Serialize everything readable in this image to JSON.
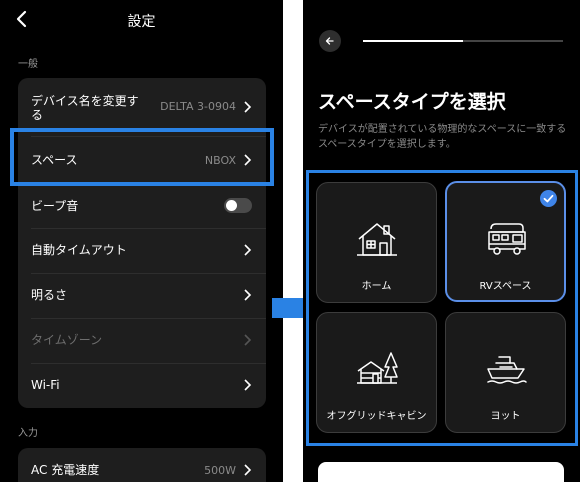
{
  "left": {
    "title": "設定",
    "section_general": "一般",
    "rows": [
      {
        "label": "デバイス名を変更する",
        "value": "DELTA 3-0904"
      },
      {
        "label": "スペース",
        "value": "NBOX"
      },
      {
        "label": "ビープ音",
        "toggle": false
      },
      {
        "label": "自動タイムアウト"
      },
      {
        "label": "明るさ"
      },
      {
        "label": "タイムゾーン",
        "disabled": true
      },
      {
        "label": "Wi-Fi"
      }
    ],
    "section_input": "入力",
    "input_rows": [
      {
        "label": "AC 充電速度",
        "value": "500W"
      }
    ]
  },
  "right": {
    "progress": 0.5,
    "title": "スペースタイプを選択",
    "description": "デバイスが配置されている物理的なスペースに一致するスペースタイプを選択します。",
    "options": [
      {
        "label": "ホーム",
        "icon": "house-icon",
        "selected": false
      },
      {
        "label": "RVスペース",
        "icon": "rv-icon",
        "selected": true
      },
      {
        "label": "オフグリッドキャビン",
        "icon": "cabin-icon",
        "selected": false
      },
      {
        "label": "ヨット",
        "icon": "yacht-icon",
        "selected": false
      }
    ]
  },
  "colors": {
    "highlight": "#2a82e4",
    "background": "#000000",
    "card": "#1e1e1e",
    "selected_border": "#5b8fe8",
    "check": "#3f84e8"
  }
}
